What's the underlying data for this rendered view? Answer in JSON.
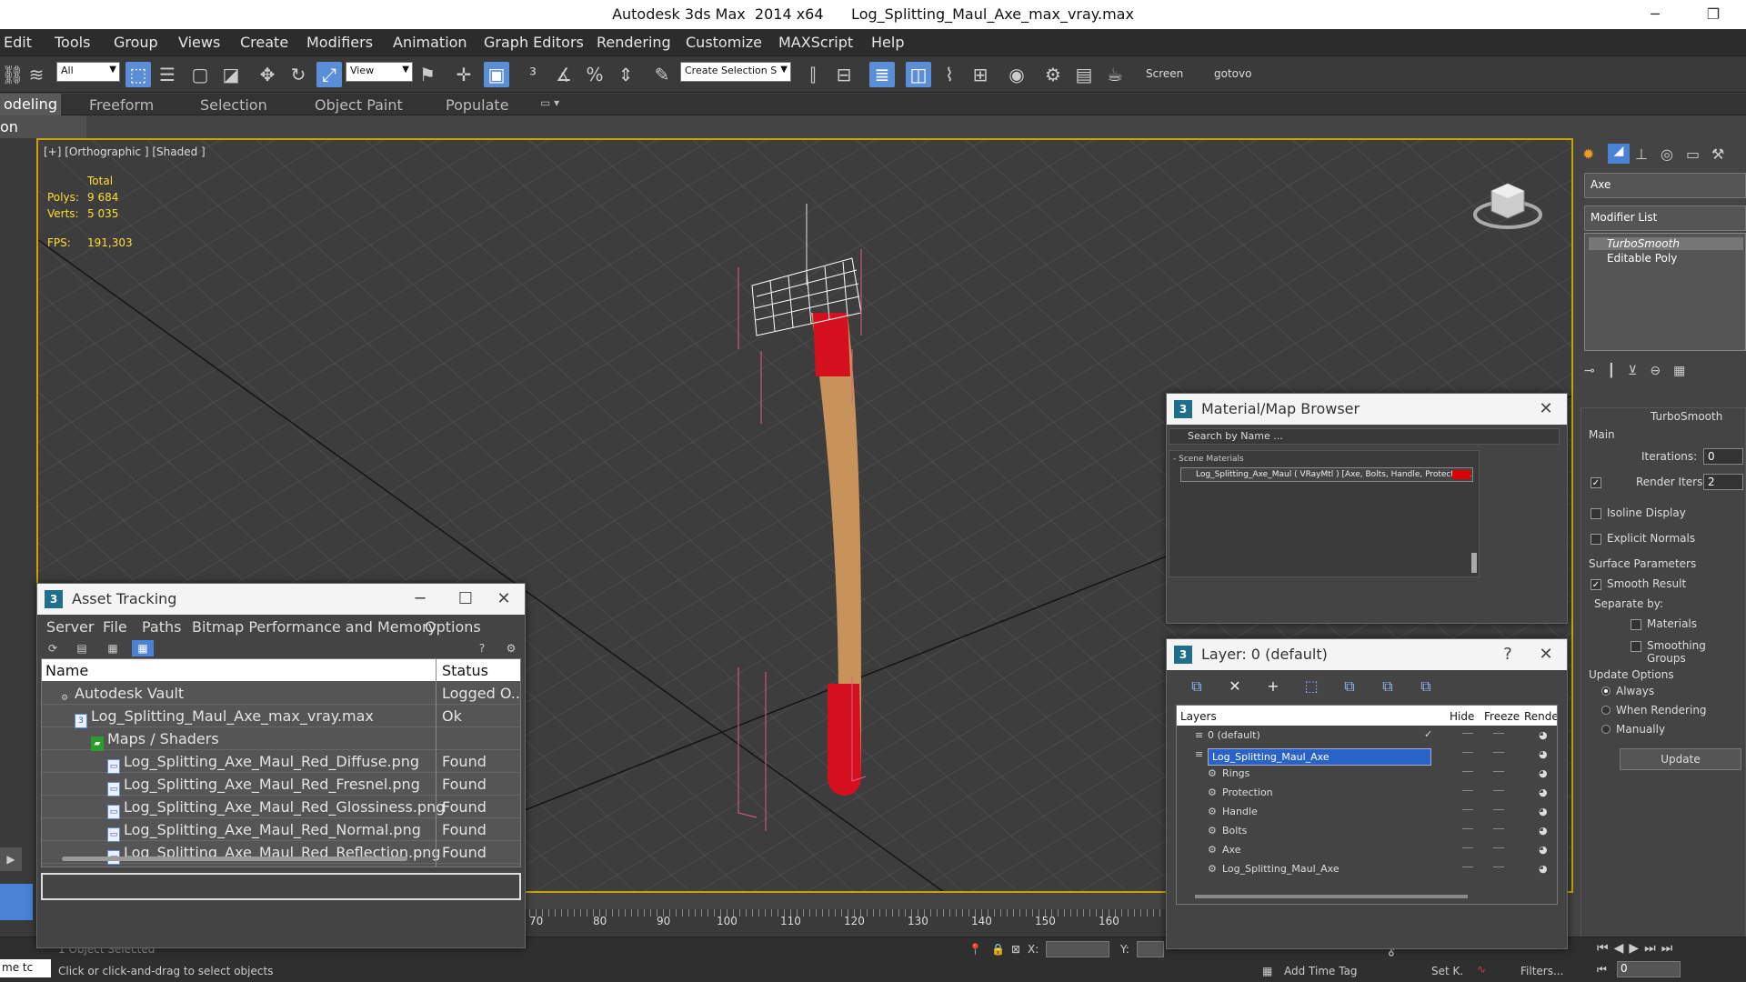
{
  "titlebar": {
    "title": "Autodesk 3ds Max  2014 x64      Log_Splitting_Maul_Axe_max_vray.max",
    "minimize": "─",
    "restore": "❐"
  },
  "menu": [
    "Edit",
    "Tools",
    "Group",
    "Views",
    "Create",
    "Modifiers",
    "Animation",
    "Graph Editors",
    "Rendering",
    "Customize",
    "MAXScript",
    "Help"
  ],
  "toolbar": {
    "selection_filter": "All",
    "ref_coord": "View",
    "named_selection": "Create Selection S",
    "screen_label": "Screen",
    "gotovo_label": "gotovo"
  },
  "ribbon": {
    "tabs": [
      "odeling",
      "Freeform",
      "Selection",
      "Object Paint",
      "Populate"
    ],
    "sub": "on Modeling"
  },
  "viewport": {
    "label": "[+] [Orthographic ] [Shaded ]",
    "stats_total": "Total",
    "polys_label": "Polys:",
    "polys_value": "9 684",
    "verts_label": "Verts:",
    "verts_value": "5 035",
    "fps_label": "FPS:",
    "fps_value": "191,303"
  },
  "command_panel": {
    "object_name": "Axe",
    "modifier_list": "Modifier List",
    "stack": [
      "TurboSmooth",
      "Editable Poly"
    ],
    "turbosmooth_title": "TurboSmooth",
    "main": "Main",
    "iterations_label": "Iterations:",
    "iterations_value": "0",
    "render_iters_label": "Render Iters:",
    "render_iters_value": "2",
    "render_iters_checked": "✓",
    "isoline": "Isoline Display",
    "explicit_normals": "Explicit Normals",
    "surface_params": "Surface Parameters",
    "smooth_result": "Smooth Result",
    "smooth_result_checked": "✓",
    "separate_by": "Separate by:",
    "materials": "Materials",
    "smoothing_groups": "Smoothing Groups",
    "update_options": "Update Options",
    "always": "Always",
    "when_rendering": "When Rendering",
    "manually": "Manually",
    "update_button": "Update"
  },
  "asset_tracking": {
    "title": "Asset Tracking",
    "menu": [
      "Server",
      "File",
      "Paths",
      "Bitmap Performance and Memory",
      "Options"
    ],
    "col_name": "Name",
    "col_status": "Status",
    "rows": [
      {
        "name": "Autodesk Vault",
        "status": "Logged O...",
        "indent": 1,
        "icon": "vault-icon"
      },
      {
        "name": "Log_Splitting_Maul_Axe_max_vray.max",
        "status": "Ok",
        "indent": 2,
        "icon": "max-file-icon"
      },
      {
        "name": "Maps / Shaders",
        "status": "",
        "indent": 3,
        "icon": "maps-folder-icon"
      },
      {
        "name": "Log_Splitting_Axe_Maul_Red_Diffuse.png",
        "status": "Found",
        "indent": 4,
        "icon": "image-file-icon"
      },
      {
        "name": "Log_Splitting_Axe_Maul_Red_Fresnel.png",
        "status": "Found",
        "indent": 4,
        "icon": "image-file-icon"
      },
      {
        "name": "Log_Splitting_Axe_Maul_Red_Glossiness.png",
        "status": "Found",
        "indent": 4,
        "icon": "image-file-icon"
      },
      {
        "name": "Log_Splitting_Axe_Maul_Red_Normal.png",
        "status": "Found",
        "indent": 4,
        "icon": "image-file-icon"
      },
      {
        "name": "Log_Splitting_Axe_Maul_Red_Reflection.png",
        "status": "Found",
        "indent": 4,
        "icon": "image-file-icon"
      }
    ]
  },
  "material_browser": {
    "title": "Material/Map Browser",
    "search_placeholder": "Search by Name ...",
    "section": "- Scene Materials",
    "item": "Log_Splitting_Axe_Maul ( VRayMtl ) [Axe, Bolts, Handle, Protection,..."
  },
  "layer_window": {
    "title": "Layer: 0 (default)",
    "help": "?",
    "col_layers": "Layers",
    "col_hide": "Hide",
    "col_freeze": "Freeze",
    "col_render": "Rende",
    "rows": [
      {
        "name": "0 (default)",
        "level": 0,
        "check": "✓"
      },
      {
        "name": "Log_Splitting_Maul_Axe",
        "level": 0,
        "selected": true
      },
      {
        "name": "Rings",
        "level": 1
      },
      {
        "name": "Protection",
        "level": 1
      },
      {
        "name": "Handle",
        "level": 1
      },
      {
        "name": "Bolts",
        "level": 1
      },
      {
        "name": "Axe",
        "level": 1
      },
      {
        "name": "Log_Splitting_Maul_Axe",
        "level": 1
      }
    ]
  },
  "timeline": {
    "ticks": [
      "70",
      "80",
      "90",
      "100",
      "110",
      "120",
      "130",
      "140",
      "150",
      "160"
    ]
  },
  "status": {
    "selected": "1 Object Selected",
    "prompt": "Click or click-and-drag to select objects",
    "add_time_tag": "Add Time Tag",
    "set_key": "Set K.",
    "filters": "Filters...",
    "frame": "0",
    "maxscript": "me  tc",
    "x_label": "X:",
    "y_label": "Y:"
  },
  "colors": {
    "accent": "#5a8fd8",
    "viewport_border": "#c8a400",
    "axe_red": "#d4101e",
    "wood": "#c8935a"
  }
}
